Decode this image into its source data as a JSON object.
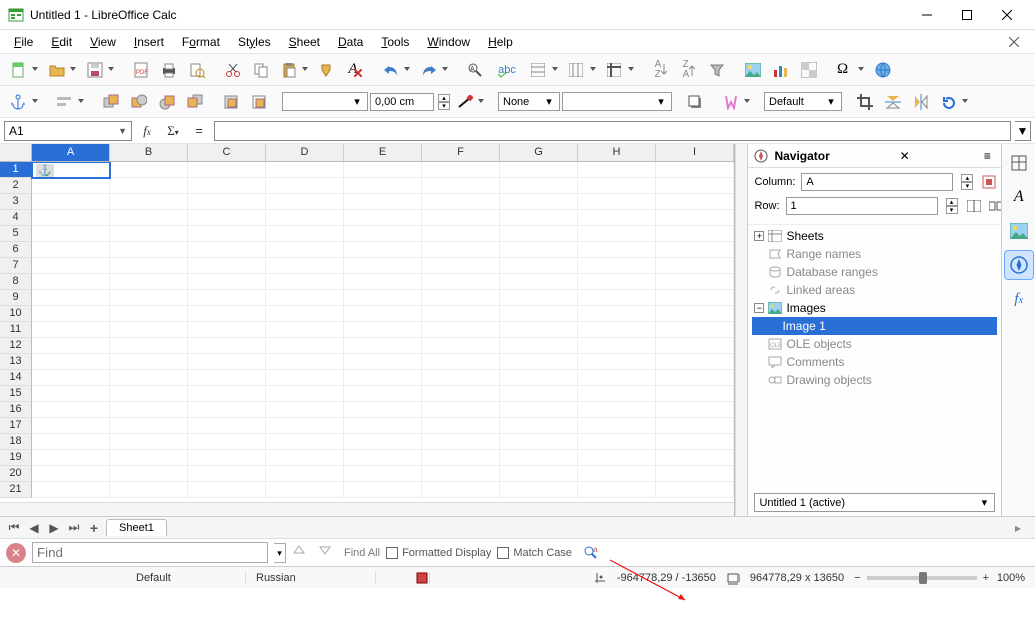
{
  "titlebar": {
    "title": "Untitled 1 - LibreOffice Calc"
  },
  "menu": {
    "file": "File",
    "edit": "Edit",
    "view": "View",
    "insert": "Insert",
    "format": "Format",
    "styles": "Styles",
    "sheet": "Sheet",
    "data": "Data",
    "tools": "Tools",
    "window": "Window",
    "help": "Help"
  },
  "toolbar2": {
    "anchor_value": "0,00 cm",
    "linestyle": "None",
    "empty": "",
    "para_style": "Default"
  },
  "formulabar": {
    "cell_ref": "A1"
  },
  "columns": [
    "A",
    "B",
    "C",
    "D",
    "E",
    "F",
    "G",
    "H",
    "I"
  ],
  "row_count": 21,
  "navigator": {
    "title": "Navigator",
    "col_label": "Column:",
    "col_value": "A",
    "row_label": "Row:",
    "row_value": "1",
    "tree": {
      "sheets": "Sheets",
      "range_names": "Range names",
      "db_ranges": "Database ranges",
      "linked_areas": "Linked areas",
      "images": "Images",
      "image1": "Image 1",
      "ole": "OLE objects",
      "comments": "Comments",
      "drawing": "Drawing objects"
    },
    "doc": "Untitled 1 (active)"
  },
  "sheet_tab": "Sheet1",
  "findbar": {
    "placeholder": "Find",
    "findall": "Find All",
    "formatted": "Formatted Display",
    "matchcase": "Match Case"
  },
  "statusbar": {
    "style": "Default",
    "lang": "Russian",
    "coords": "-964778,29 / -13650",
    "size": "964778,29 x 13650",
    "zoom": "100%"
  }
}
